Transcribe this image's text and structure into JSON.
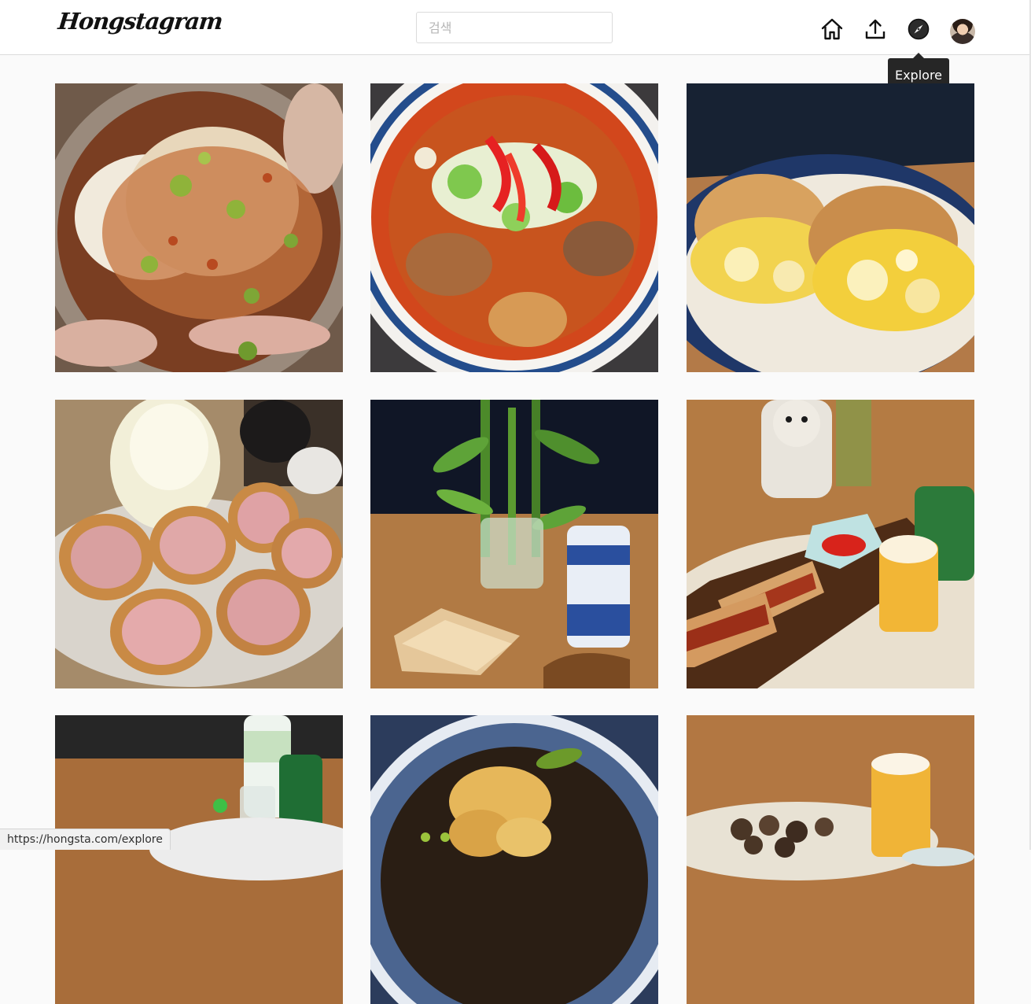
{
  "app": {
    "logo": "Hongstagram"
  },
  "header": {
    "search_placeholder": "검색",
    "nav": {
      "home_icon": "home-icon",
      "upload_icon": "upload-icon",
      "explore_icon": "compass-icon",
      "profile_icon": "avatar"
    }
  },
  "tooltip": {
    "text": "Explore"
  },
  "posts": [
    {
      "icon": "photo-spicy-pork-tofu"
    },
    {
      "icon": "photo-spicy-beef-tripe-soup"
    },
    {
      "icon": "photo-scrambled-egg-buns"
    },
    {
      "icon": "photo-pork-katsu-cabbage"
    },
    {
      "icon": "photo-grilled-sandwich-beer-bamboo"
    },
    {
      "icon": "photo-hotdogs-beer-ketchup"
    },
    {
      "icon": "photo-soju-beer-table"
    },
    {
      "icon": "photo-shrimp-tempura-soba"
    },
    {
      "icon": "photo-beer-sausages"
    }
  ],
  "status_bar": {
    "url": "https://hongsta.com/explore"
  },
  "colors": {
    "header_bg": "#ffffff",
    "page_bg": "#fafafa",
    "tooltip_bg": "#262626",
    "border": "#dbdbdb"
  }
}
